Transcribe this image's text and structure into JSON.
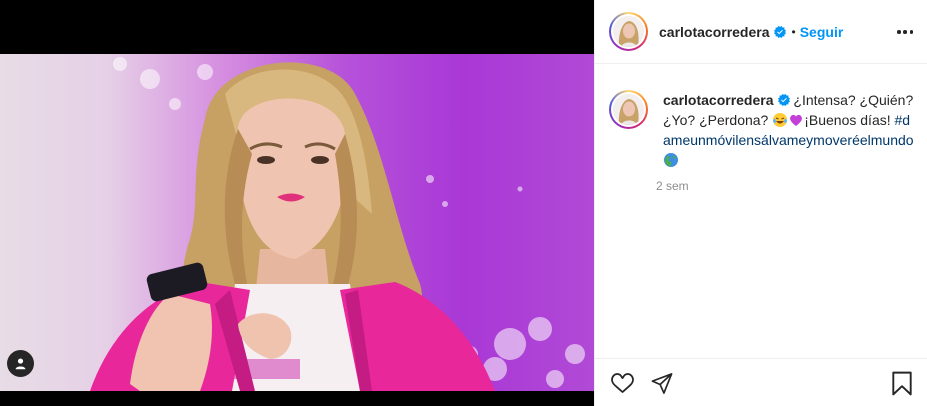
{
  "post": {
    "author": {
      "username": "carlotacorredera",
      "verified": true
    },
    "header": {
      "separator": "•",
      "follow_label": "Seguir"
    },
    "caption": {
      "username": "carlotacorredera",
      "text_before_emoji": " ¿Intensa? ¿Quién? ¿Yo? ¿Perdona? ",
      "emojis": [
        "laughing-tears-emoji",
        "purple-heart-emoji"
      ],
      "text_after_emoji": "¡Buenos días! ",
      "hashtag": "#dameunmóvilensálvameymoveréelmundo",
      "trailing_emoji": "globe-emoji"
    },
    "timestamp": "2 sem",
    "colors": {
      "accent": "#0095f6",
      "hashtag": "#00376b",
      "jacket_pink": "#e8279a",
      "background_purple": "#a938d6"
    },
    "icons": {
      "like": "heart-icon",
      "share": "paper-plane-icon",
      "save": "bookmark-icon",
      "more": "more-options-icon",
      "tag": "user-tag-icon"
    }
  }
}
